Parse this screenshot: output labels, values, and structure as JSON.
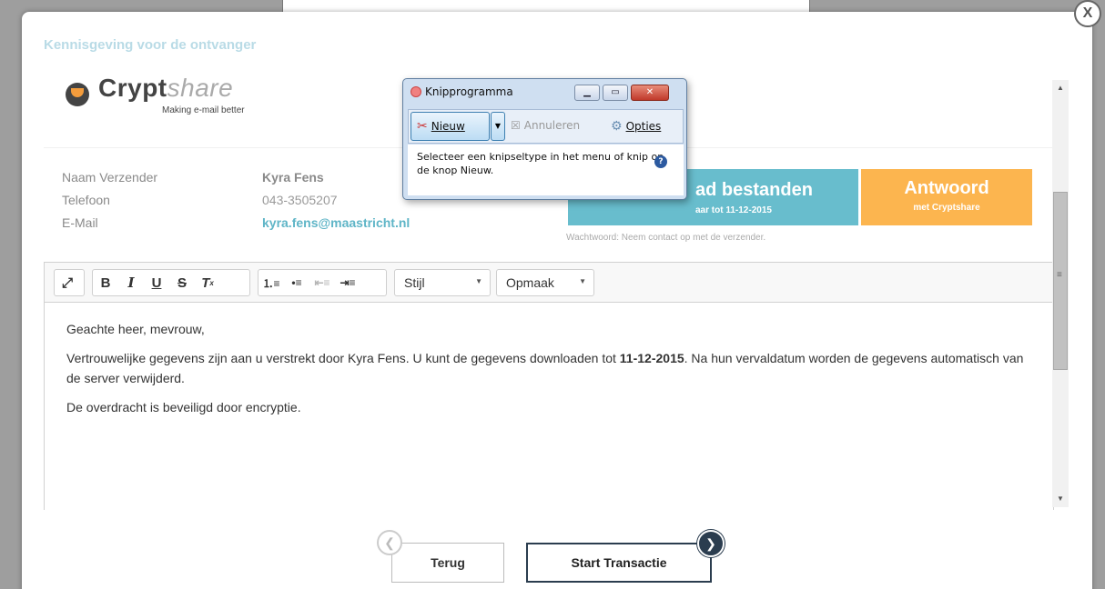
{
  "modal": {
    "title": "Kennisgeving voor de ontvanger",
    "close_label": "X"
  },
  "header": {
    "logo_bold": "Crypt",
    "logo_thin": "share",
    "tagline": "Making e-mail better"
  },
  "sender": {
    "rows": [
      {
        "label": "Naam Verzender",
        "value": "Kyra Fens"
      },
      {
        "label": "Telefoon",
        "value": "043-3505207"
      },
      {
        "label": "E-Mail",
        "value": "kyra.fens@maastricht.nl"
      }
    ]
  },
  "actions": {
    "download_title": "ad bestanden",
    "download_sub": "aar tot 11-12-2015",
    "answer_title": "Antwoord",
    "answer_sub": "met Cryptshare",
    "password_note": "Wachtwoord: Neem contact op met de verzender."
  },
  "editor": {
    "style_combo": "Stijl",
    "format_combo": "Opmaak",
    "greeting": "Geachte heer, mevrouw,",
    "p1_before": "Vertrouwelijke gegevens zijn aan u verstrekt door Kyra Fens. U kunt de gegevens downloaden tot ",
    "p1_date": "11-12-2015",
    "p1_after": ". Na hun vervaldatum worden de gegevens automatisch van de server verwijderd.",
    "p2": "De overdracht is beveiligd door encryptie."
  },
  "nav": {
    "back_label": "Terug",
    "start_label": "Start Transactie"
  },
  "snipping_tool": {
    "title": "Knipprogramma",
    "new_label": "Nieuw",
    "cancel_label": "Annuleren",
    "options_label": "Opties",
    "message": "Selecteer een knipseltype in het menu of knip op de knop Nieuw."
  },
  "colors": {
    "download_bg": "#68bdcd",
    "answer_bg": "#fcb54f",
    "link": "#5fb5c7",
    "nav_dark": "#2b3d4f"
  }
}
